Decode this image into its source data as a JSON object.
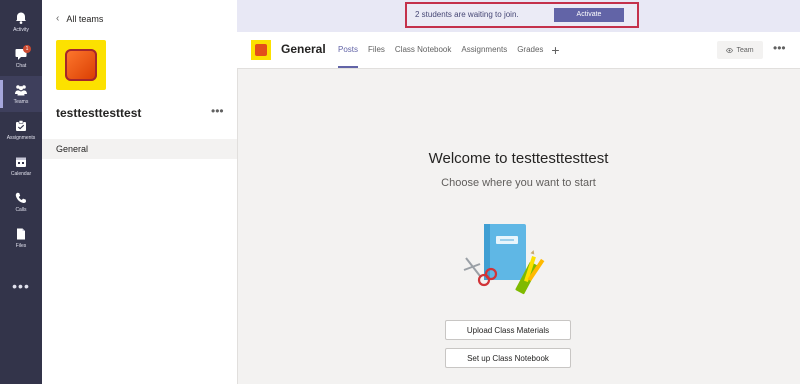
{
  "rail": {
    "items": [
      {
        "label": "Activity",
        "icon": "bell-icon"
      },
      {
        "label": "Chat",
        "icon": "chat-icon",
        "badge": "1"
      },
      {
        "label": "Teams",
        "icon": "teams-icon",
        "active": true
      },
      {
        "label": "Assignments",
        "icon": "assignments-icon"
      },
      {
        "label": "Calendar",
        "icon": "calendar-icon"
      },
      {
        "label": "Calls",
        "icon": "phone-icon"
      },
      {
        "label": "Files",
        "icon": "files-icon"
      }
    ],
    "more": "•••"
  },
  "panel": {
    "back_label": "All teams",
    "team_name": "testtesttesttest",
    "more": "•••",
    "channels": [
      "General"
    ]
  },
  "notice": {
    "text": "2 students are waiting to join.",
    "button": "Activate"
  },
  "header": {
    "channel": "General",
    "tabs": [
      "Posts",
      "Files",
      "Class Notebook",
      "Assignments",
      "Grades"
    ],
    "active_tab": "Posts",
    "add": "+",
    "team_chip": "Team",
    "more": "•••"
  },
  "main": {
    "title": "Welcome to testtesttesttest",
    "subtitle": "Choose where you want to start",
    "buttons": {
      "upload": "Upload Class Materials",
      "notebook": "Set up Class Notebook"
    }
  },
  "colors": {
    "rail": "#33344a",
    "accent": "#6264a7",
    "highlight_border": "#c4314b",
    "team_yellow": "#fce100"
  }
}
